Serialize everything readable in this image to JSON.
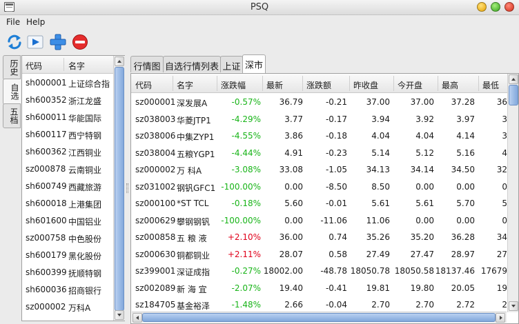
{
  "window": {
    "title": "PSQ"
  },
  "menu": {
    "file": "File",
    "help": "Help"
  },
  "side_tabs": [
    "历史",
    "自选",
    "五档"
  ],
  "left_table": {
    "headers": [
      "代码",
      "名字"
    ],
    "rows": [
      [
        "sh000001",
        "上证综合指"
      ],
      [
        "sh600352",
        "浙江龙盛"
      ],
      [
        "sh600011",
        "华能国际"
      ],
      [
        "sh600117",
        "西宁特钢"
      ],
      [
        "sh600362",
        "江西铜业"
      ],
      [
        "sz000878",
        "云南铜业"
      ],
      [
        "sh600749",
        "西藏旅游"
      ],
      [
        "sh600018",
        "上港集团"
      ],
      [
        "sh601600",
        "中国铝业"
      ],
      [
        "sz000758",
        "中色股份"
      ],
      [
        "sh600179",
        "黑化股份"
      ],
      [
        "sh600399",
        "抚顺特钢"
      ],
      [
        "sh600036",
        "招商银行"
      ],
      [
        "sz000002",
        "万科A"
      ]
    ]
  },
  "tabs": [
    "行情图",
    "自选行情列表",
    "上证",
    "深市"
  ],
  "active_tab": "深市",
  "quote_table": {
    "headers": [
      "代码",
      "名字",
      "涨跌幅",
      "最新",
      "涨跌额",
      "昨收盘",
      "今开盘",
      "最高",
      "最低"
    ],
    "rows": [
      [
        "sz000001",
        "深发展A",
        "-0.57%",
        "36.79",
        "-0.21",
        "37.00",
        "37.00",
        "37.28",
        "36"
      ],
      [
        "sz038003",
        "华菱JTP1",
        "-4.29%",
        "3.77",
        "-0.17",
        "3.94",
        "3.92",
        "3.97",
        "3"
      ],
      [
        "sz038006",
        "中集ZYP1",
        "-4.55%",
        "3.86",
        "-0.18",
        "4.04",
        "4.04",
        "4.14",
        "3"
      ],
      [
        "sz038004",
        "五粮YGP1",
        "-4.44%",
        "4.91",
        "-0.23",
        "5.14",
        "5.12",
        "5.16",
        "4"
      ],
      [
        "sz000002",
        "万  科A",
        "-3.08%",
        "33.08",
        "-1.05",
        "34.13",
        "34.14",
        "34.50",
        "32"
      ],
      [
        "sz031002",
        "钢钒GFC1",
        "-100.00%",
        "0.00",
        "-8.50",
        "8.50",
        "0.00",
        "0.00",
        "0"
      ],
      [
        "sz000100",
        "*ST TCL",
        "-0.18%",
        "5.60",
        "-0.01",
        "5.61",
        "5.61",
        "5.70",
        "5"
      ],
      [
        "sz000629",
        "攀钢钢钒",
        "-100.00%",
        "0.00",
        "-11.06",
        "11.06",
        "0.00",
        "0.00",
        "0"
      ],
      [
        "sz000858",
        "五 粮 液",
        "+2.10%",
        "36.00",
        "0.74",
        "35.26",
        "35.20",
        "36.28",
        "34"
      ],
      [
        "sz000630",
        "铜都铜业",
        "+2.11%",
        "28.07",
        "0.58",
        "27.49",
        "27.47",
        "28.97",
        "27"
      ],
      [
        "sz399001",
        "深证成指",
        "-0.27%",
        "18002.00",
        "-48.78",
        "18050.78",
        "18050.58",
        "18137.46",
        "17679"
      ],
      [
        "sz002089",
        "新 海 宜",
        "-2.07%",
        "19.40",
        "-0.41",
        "19.81",
        "19.80",
        "20.05",
        "19"
      ],
      [
        "sz184705",
        "基金裕泽",
        "-1.48%",
        "2.66",
        "-0.04",
        "2.70",
        "2.70",
        "2.72",
        "2"
      ]
    ]
  },
  "colors": {
    "up": "#e0001a",
    "down": "#18b418"
  },
  "toolbar_icons": [
    "refresh-icon",
    "play-icon",
    "add-icon",
    "stop-icon"
  ]
}
